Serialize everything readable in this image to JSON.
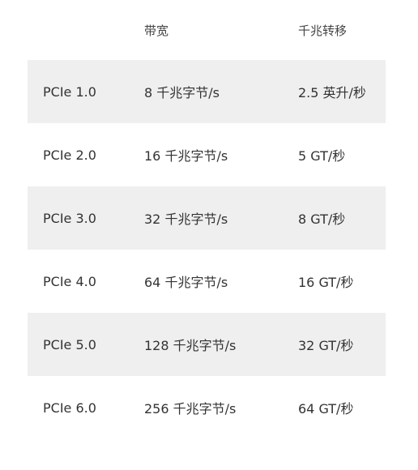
{
  "table": {
    "headers": [
      "",
      "带宽",
      "千兆转移"
    ],
    "rows": [
      [
        "PCIe 1.0",
        "8 千兆字节/s",
        "2.5 英升/秒"
      ],
      [
        "PCIe 2.0",
        "16 千兆字节/s",
        "5 GT/秒"
      ],
      [
        "PCIe 3.0",
        "32 千兆字节/s",
        "8 GT/秒"
      ],
      [
        "PCIe 4.0",
        "64 千兆字节/s",
        "16 GT/秒"
      ],
      [
        "PCIe 5.0",
        "128 千兆字节/s",
        "32 GT/秒"
      ],
      [
        "PCIe 6.0",
        "256 千兆字节/s",
        "64 GT/秒"
      ]
    ]
  },
  "colors": {
    "shaded_row": "#efefef",
    "text": "#333333",
    "background": "#ffffff"
  }
}
